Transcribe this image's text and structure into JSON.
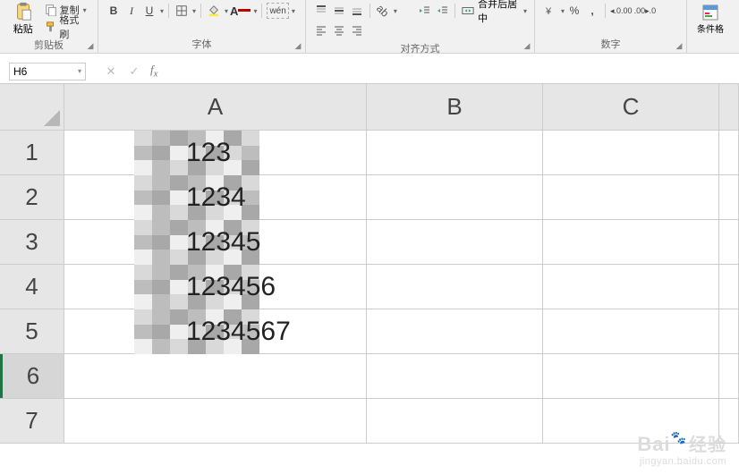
{
  "ribbon": {
    "clipboard": {
      "paste": "粘贴",
      "copy": "复制",
      "format_painter": "格式刷",
      "label": "剪贴板"
    },
    "font": {
      "bold": "B",
      "italic": "I",
      "underline": "U",
      "wen": "wén",
      "label": "字体"
    },
    "alignment": {
      "merge": "合并后居中",
      "label": "对齐方式"
    },
    "number": {
      "percent": "%",
      "comma": ",",
      "inc_dec": ".0",
      "dec_inc": ".00",
      "label": "数字"
    },
    "styles": {
      "conditional": "条件格"
    }
  },
  "formula_bar": {
    "cell_ref": "H6",
    "formula": ""
  },
  "columns": [
    "A",
    "B",
    "C"
  ],
  "rows": [
    {
      "num": "1",
      "a_suffix": "123"
    },
    {
      "num": "2",
      "a_suffix": "1234"
    },
    {
      "num": "3",
      "a_suffix": "12345"
    },
    {
      "num": "4",
      "a_suffix": "123456"
    },
    {
      "num": "5",
      "a_suffix": "1234567"
    },
    {
      "num": "6",
      "a_suffix": ""
    },
    {
      "num": "7",
      "a_suffix": ""
    }
  ],
  "watermark": {
    "brand": "Bai",
    "brand_cn": "经验",
    "url": "jingyan.baidu.com"
  }
}
